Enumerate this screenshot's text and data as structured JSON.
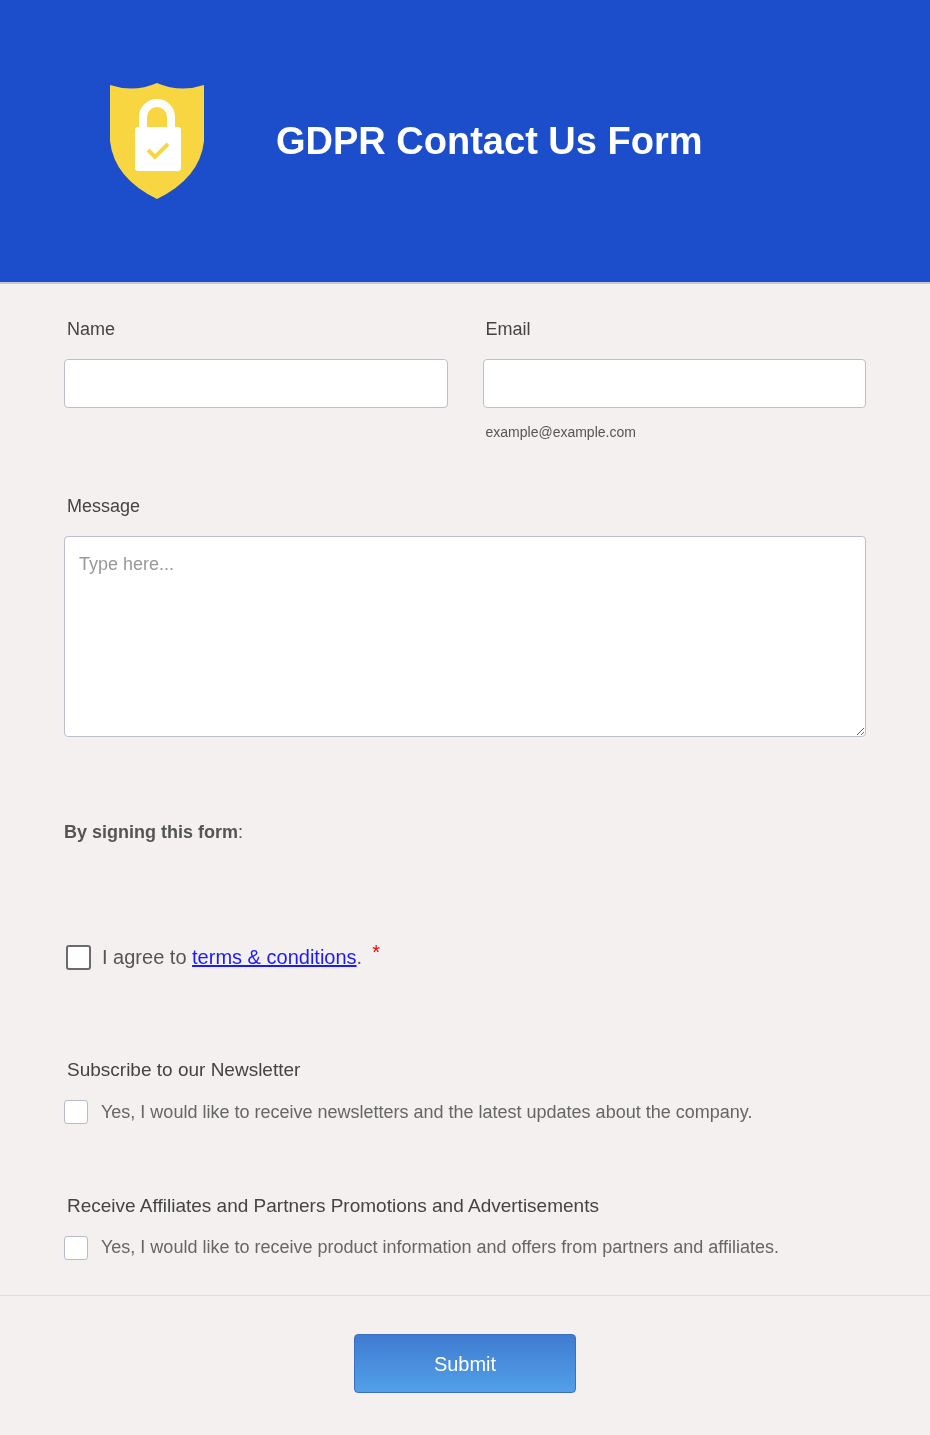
{
  "header": {
    "title": "GDPR Contact Us Form"
  },
  "fields": [
    {
      "label": "Name"
    },
    {
      "label": "Email",
      "hint": "example@example.com"
    }
  ],
  "message": {
    "label": "Message",
    "placeholder": "Type here..."
  },
  "signing_heading": "**By signing this form**:",
  "agree": {
    "prefix": "I agree to ",
    "link": "terms & conditions",
    "suffix": ".",
    "required_mark": "*",
    "checked": false
  },
  "options": [
    {
      "heading": "Subscribe to our Newsletter",
      "label": "Yes, I would like to receive newsletters and the latest updates about the company.",
      "checked": false
    },
    {
      "heading": "Receive Affiliates and Partners Promotions and Advertisements",
      "label": "Yes, I would like to receive product information and offers from partners and affiliates.",
      "checked": false
    }
  ],
  "submit": "Submit"
}
